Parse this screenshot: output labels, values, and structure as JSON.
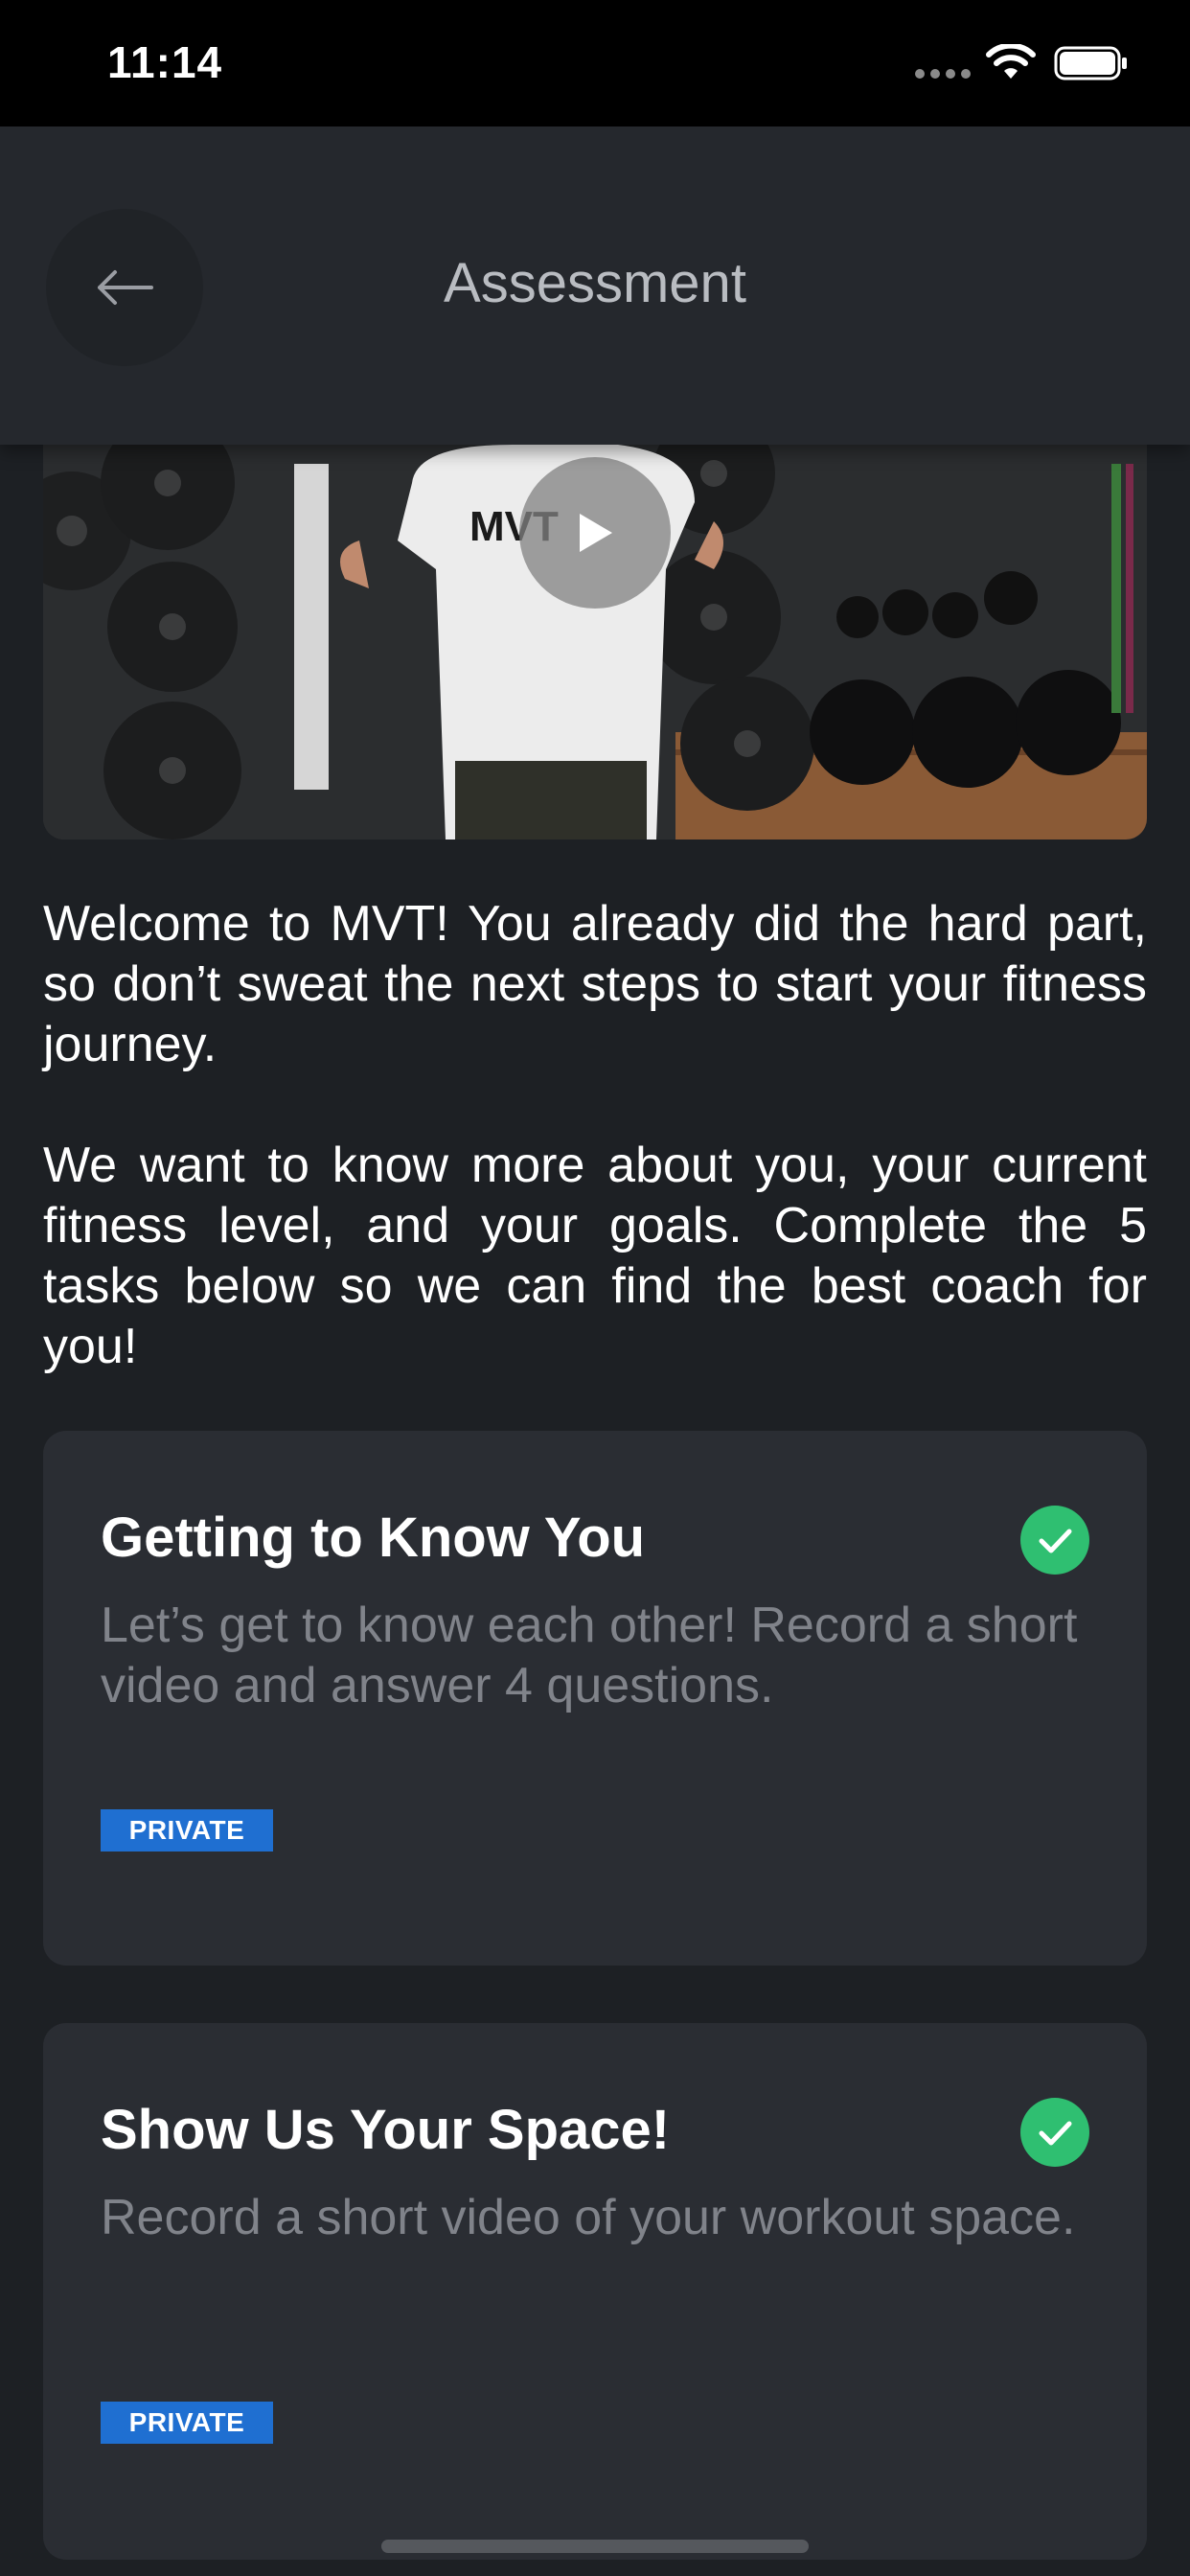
{
  "status_bar": {
    "time": "11:14"
  },
  "header": {
    "title": "Assessment",
    "back_icon": "arrow-left-icon"
  },
  "video": {
    "play_icon": "play-icon"
  },
  "intro": {
    "paragraph_1": "Welcome to MVT! You already did the hard part, so don’t sweat the next steps to start your fitness journey.",
    "paragraph_2": "We want to know more about you, your current fitness level, and your goals. Complete the 5 tasks below so we can find the best coach for you!"
  },
  "tasks": [
    {
      "title": "Getting to Know You",
      "description": "Let’s get to know each other! Record a short video and answer 4 questions.",
      "badge": "PRIVATE",
      "completed": true
    },
    {
      "title": "Show Us Your Space!",
      "description": "Record a short video of your workout space.",
      "badge": "PRIVATE",
      "completed": true
    }
  ],
  "colors": {
    "background": "#1d2024",
    "card": "#2a2d33",
    "accent_green": "#2fbf71",
    "badge_blue": "#1f6fd1"
  }
}
